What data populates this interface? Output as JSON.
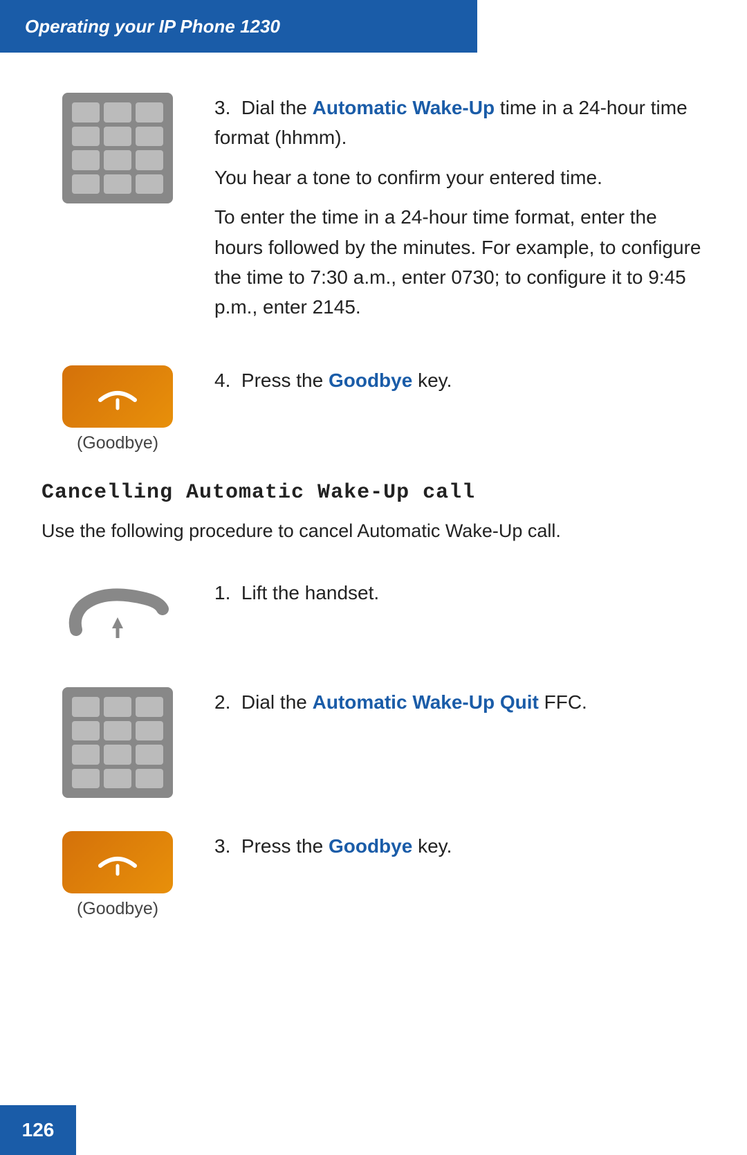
{
  "header": {
    "title": "Operating your IP Phone 1230",
    "background_color": "#1a5ca8"
  },
  "page_number": "126",
  "steps_section1": [
    {
      "number": "3",
      "image_type": "keypad",
      "paragraphs": [
        "Dial the <span class='blue-bold'>Automatic Wake-Up</span> time in a 24-hour time format (hhmm).",
        "You hear a tone to confirm your entered time.",
        "To enter the time in a 24-hour time format, enter the hours followed by the minutes. For example, to configure the time to 7:30 a.m., enter 0730; to configure it to 9:45 p.m., enter 2145."
      ]
    },
    {
      "number": "4",
      "image_type": "goodbye",
      "label": "(Goodbye)",
      "text": "Press the <span class='blue-bold'>Goodbye</span> key."
    }
  ],
  "section2": {
    "title": "Cancelling Automatic Wake-Up call",
    "intro": "Use the following procedure to cancel Automatic Wake-Up call."
  },
  "steps_section2": [
    {
      "number": "1",
      "image_type": "handset",
      "text": "Lift the handset."
    },
    {
      "number": "2",
      "image_type": "keypad",
      "text": "Dial the <span class='blue-bold'>Automatic Wake-Up Quit</span> FFC."
    },
    {
      "number": "3",
      "image_type": "goodbye",
      "label": "(Goodbye)",
      "text": "Press the <span class='blue-bold'>Goodbye</span> key."
    }
  ],
  "labels": {
    "goodbye": "(Goodbye)",
    "automatic_wake_up": "Automatic Wake-Up",
    "automatic_wake_up_quit": "Automatic Wake-Up Quit",
    "goodbye_key": "Goodbye"
  }
}
